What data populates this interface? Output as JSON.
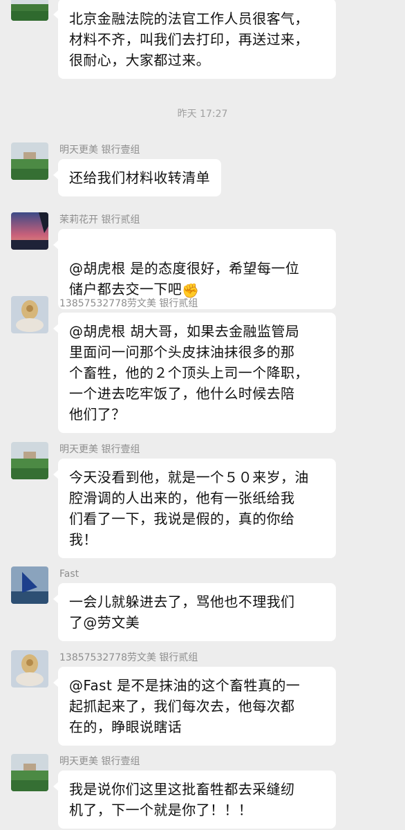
{
  "messages_top": {
    "bubble_text": "北京金融法院的法官工作人员很客气，\n材料不齐，叫我们去打印，再送过来，\n很耐心，大家都过来。"
  },
  "timestamp": "昨天 17:27",
  "messages": [
    {
      "sender": "明天更美  银行壹组",
      "text": "还给我们材料收转清单",
      "avatar": "field-landscape"
    },
    {
      "sender": "茉莉花开  银行贰组",
      "text": "@胡虎根  是的态度很好，希望每一位\n储户都去交一下吧",
      "emoji": "✊",
      "avatar": "sunset-landscape"
    },
    {
      "sender": "13857532778劳文美  银行贰组",
      "text": "@胡虎根  胡大哥，如果去金融监管局\n里面问一问那个头皮抹油抹很多的那\n个畜牲，他的２个顶头上司一个降职，\n一个进去吃牢饭了，他什么时候去陪\n他们了？",
      "avatar": "deity-statue"
    },
    {
      "sender": "明天更美  银行壹组",
      "text": "今天没看到他，就是一个５０来岁，油\n腔滑调的人出来的，他有一张纸给我\n们看了一下，我说是假的，真的你给\n我！",
      "avatar": "field-landscape"
    },
    {
      "sender": "Fast",
      "text": "一会儿就躲进去了，骂他也不理我们\n了@劳文美",
      "avatar": "sailboat"
    },
    {
      "sender": "13857532778劳文美  银行贰组",
      "text": "@Fast  是不是抹油的这个畜牲真的一\n起抓起来了，我们每次去，他每次都\n在的，睁眼说瞎话",
      "avatar": "deity-statue"
    },
    {
      "sender": "明天更美  银行壹组",
      "text": "我是说你们这里这批畜牲都去采缝纫\n机了，下一个就是你了！！！",
      "avatar": "field-landscape"
    }
  ]
}
